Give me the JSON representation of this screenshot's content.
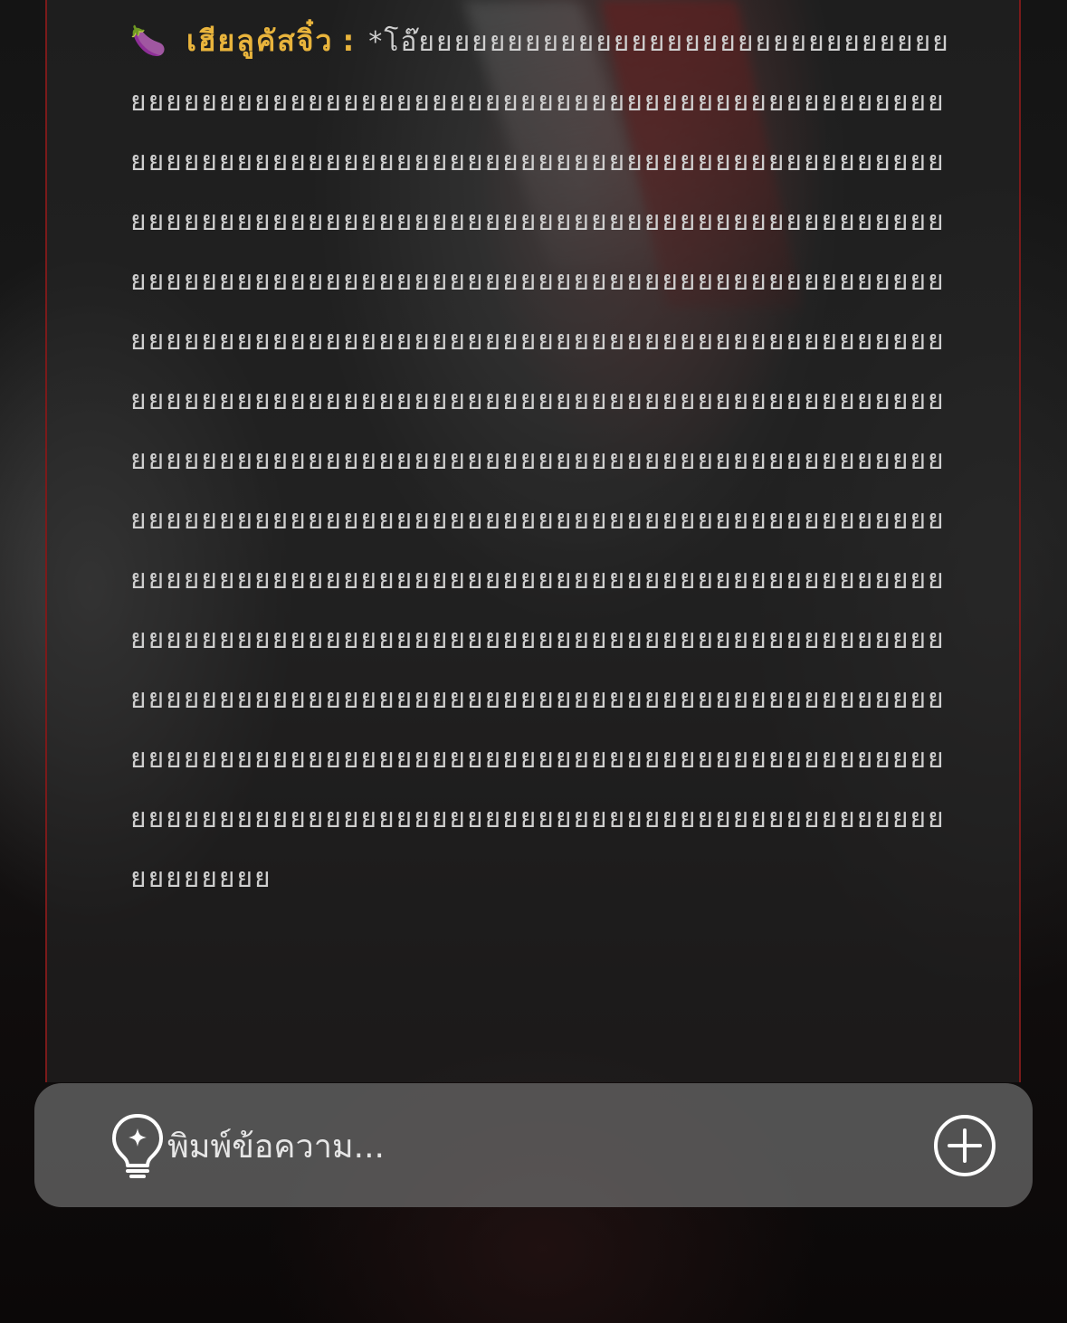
{
  "message": {
    "emoji_icon": "eggplant-icon",
    "emoji": "🍆",
    "sender": "เฮียลูคัสจิ๋ว",
    "separator": ":",
    "text": "*โอ๊ยยยยยยยยยยยยยยยยยยยยยยยยยยยยยยยยยยยยยยยยยยยยยยยยยยยยยยยยยยยยยยยยยยยยยยยยยยยยยยยยยยยยยยยยยยยยยยยยยยยยยยยยยยยยยยยยยยยยยยยยยยยยยยยยยยยยยยยยยยยยยยยยยยยยยยยยยยยยยยยยยยยยยยยยยยยยยยยยยยยยยยยยยยยยยยยยยยยยยยยยยยยยยยยยยยยยยยยยยยยยยยยยยยยยยยยยยยยยยยยยยยยยยยยยยยยยยยยยยยยยยยยยยยยยยยยยยยยยยยยยยยยยยยยยยยยยยยยยยยยยยยยยยยยยยยยยยยยยยยยยยยยยยยยยยยยยยยยยยยยยยยยยยยยยยยยยยยยยยยยยยยยยยยยยยยยยยยยยยยยยยยยยยยยยยยยยยยยยยยยยยยยยยยยยยยยยยยยยยยยยยยยยยยยยยยยยยยยยยยยยยยยยยยยยยยยยยยยยยยยยยยยยยยยยยยยยยยยยยยยยยยยยยยยยยยยยยยยยยยยยยยยยยยยยยยยยยยยยยยยยยยยยยยยยยยยยยยยยยยยยยยยยยยยยยยยยยยยยยยยยยยยยยยยยยยยยยยยยยยยยยยยยยยยยยยยยยยยยยยยยยยยยยยยยยยยยยยยยยยยยยยยยยยยยยยยยยยยย"
  },
  "input": {
    "placeholder": "พิมพ์ข้อความ...",
    "left_icon": "lightbulb-sparkle-icon",
    "right_icon": "plus-circle-icon"
  },
  "colors": {
    "sender": "#e9b43c",
    "message_text": "#cfcfcf",
    "panel_border": "#7a1a1a",
    "input_bar": "#6e6e6e"
  }
}
